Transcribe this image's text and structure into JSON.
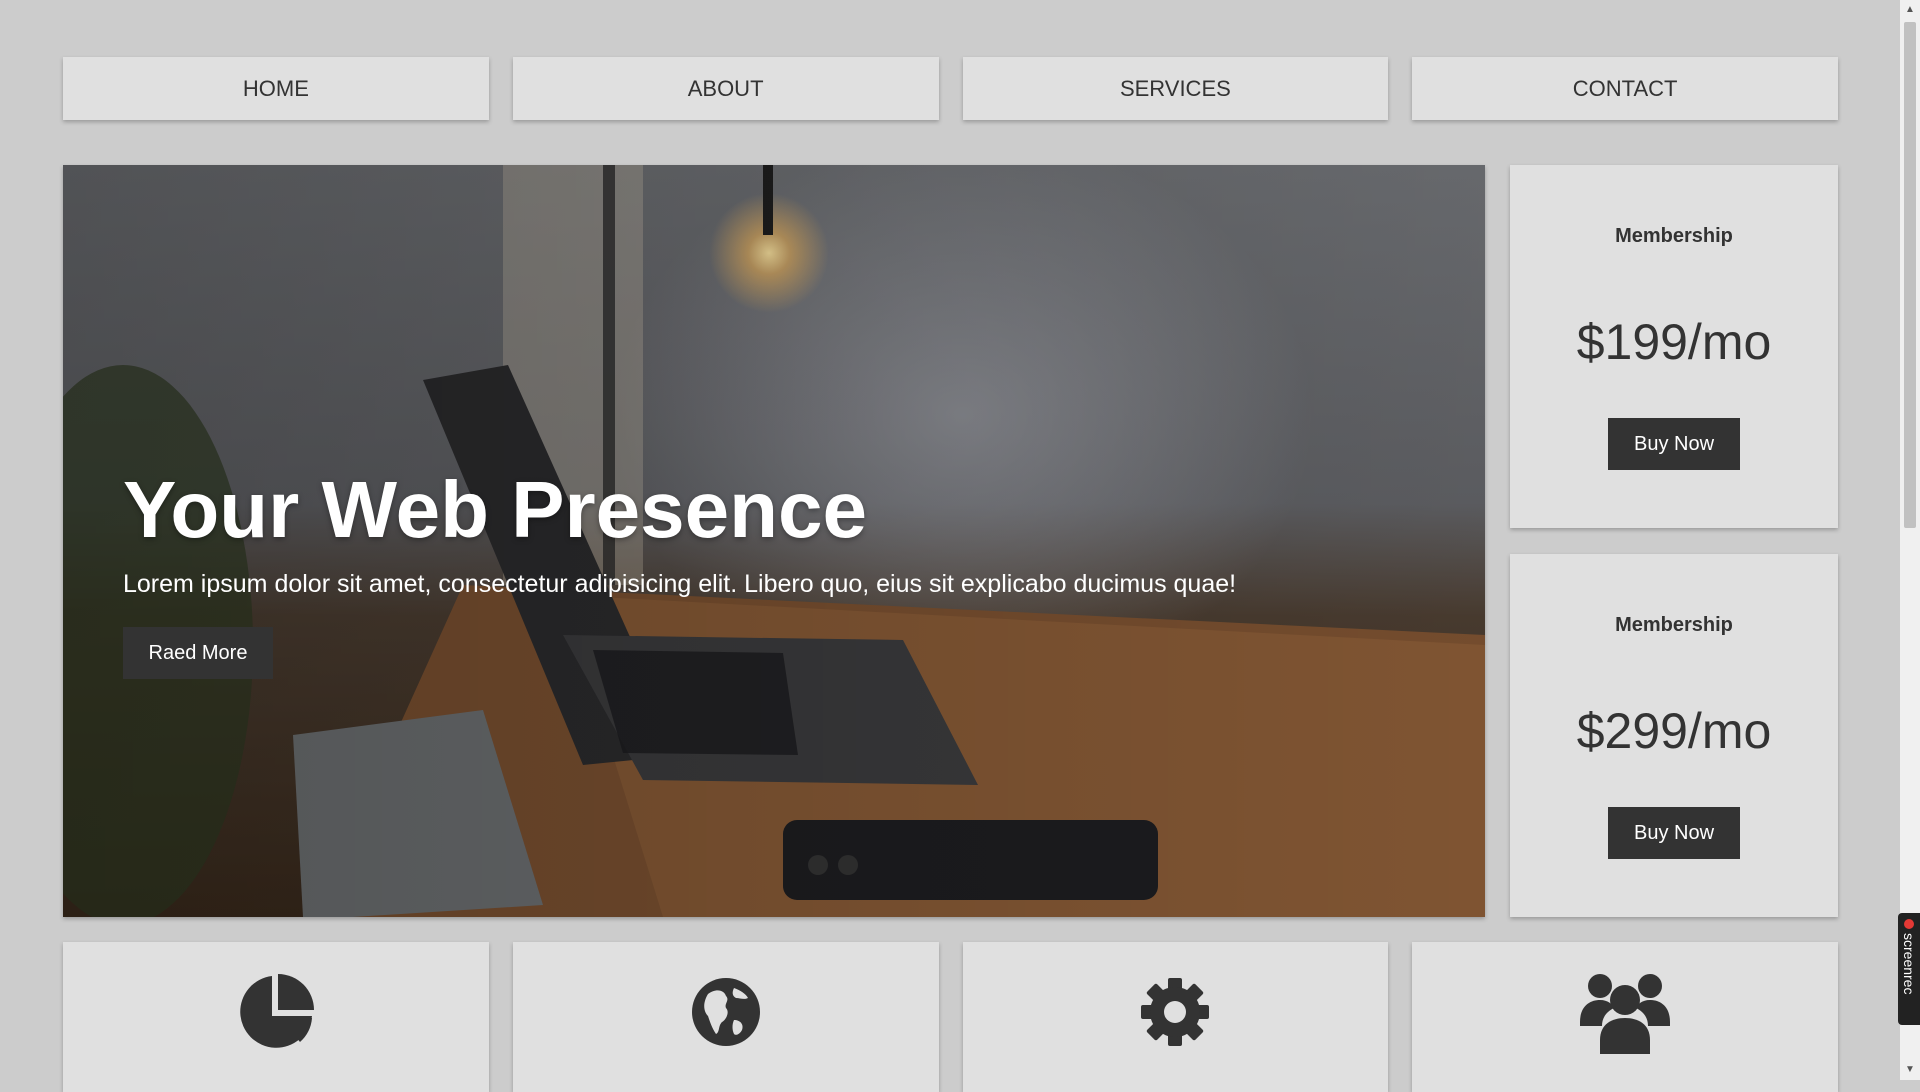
{
  "nav": {
    "items": [
      {
        "label": "HOME"
      },
      {
        "label": "ABOUT"
      },
      {
        "label": "SERVICES"
      },
      {
        "label": "CONTACT"
      }
    ]
  },
  "hero": {
    "title": "Your Web Presence",
    "text": "Lorem ipsum dolor sit amet, consectetur adipisicing elit. Libero quo, eius sit explicabo ducimus quae!",
    "button_label": "Raed More"
  },
  "pricing": [
    {
      "title": "Membership",
      "price": "$199/mo",
      "button_label": "Buy Now"
    },
    {
      "title": "Membership",
      "price": "$299/mo",
      "button_label": "Buy Now"
    }
  ],
  "features": [
    {
      "icon": "pie-chart-icon"
    },
    {
      "icon": "globe-icon"
    },
    {
      "icon": "gear-icon"
    },
    {
      "icon": "users-icon"
    }
  ],
  "recorder": {
    "label": "screenrec"
  },
  "colors": {
    "background": "#cccccc",
    "card": "#e0e0e0",
    "button": "#333333",
    "text": "#333333"
  }
}
